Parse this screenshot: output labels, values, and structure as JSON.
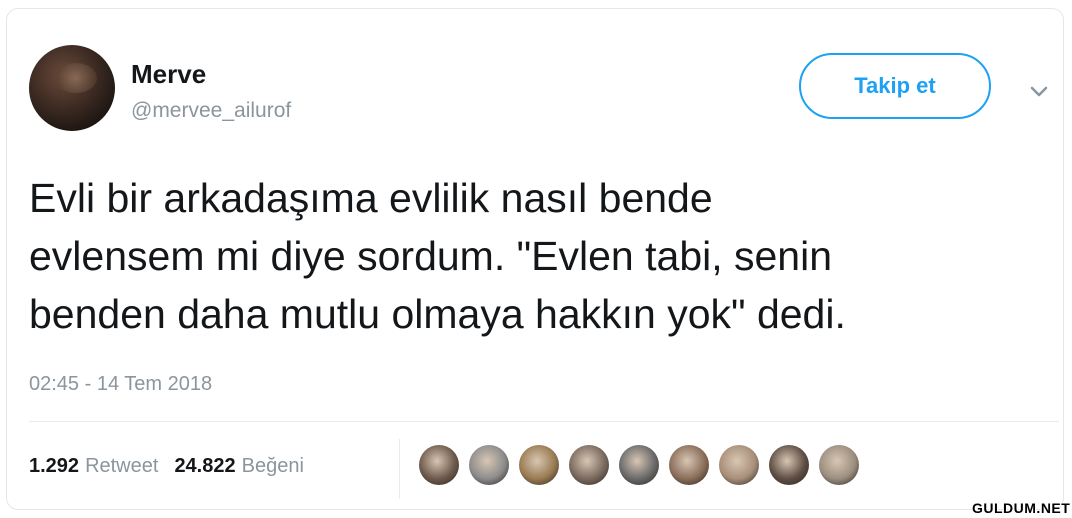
{
  "user": {
    "name": "Merve",
    "handle": "@mervee_ailurof",
    "avatar_icon": "profile-photo"
  },
  "follow_button": {
    "label": "Takip et"
  },
  "menu": {
    "icon": "chevron-down-icon"
  },
  "tweet": {
    "lines": [
      "Evli bir arkadaşıma evlilik nasıl bende",
      "evlensem mi diye sordum. \"Evlen tabi, senin",
      "benden daha mutlu olmaya hakkın yok\" dedi."
    ],
    "timestamp": "02:45 - 14 Tem 2018"
  },
  "stats": {
    "retweet_count": "1.292",
    "retweet_label": "Retweet",
    "like_count": "24.822",
    "like_label": "Beğeni"
  },
  "likers_count": 9,
  "watermark": "GULDUM.NET",
  "colors": {
    "accent": "#1da1f2",
    "text": "#14171a",
    "muted": "#8a959e"
  }
}
